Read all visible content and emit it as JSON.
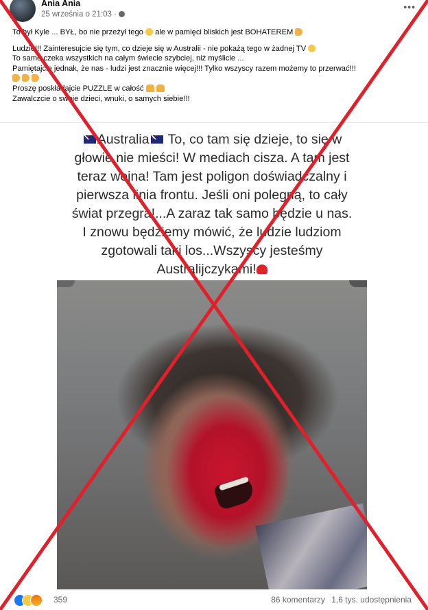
{
  "post": {
    "author": "Ania Ania",
    "timestamp": "25 września o 21:03 ·",
    "privacy_icon": "globe-icon",
    "more_icon": "ellipsis-icon",
    "text": {
      "line1": "To był Kyle ... BYŁ, bo nie przeżył tego",
      "line1_tail": "ale w pamięci bliskich jest BOHATEREM",
      "line2": "Ludzie!!! Zainteresujcie się tym, co dzieje się w Australii  - nie pokażą tego w żadnej TV",
      "line3": "To samo czeka wszystkich na całym świecie szybciej, niż myślicie ...",
      "line4": "Pamiętajcie jednak, że nas - ludzi jest znacznie więcej!!! Tylko wszyscy razem możemy to przerwać!!!",
      "line5": "Proszę poskładajcie PUZZLE w całość",
      "line6": "Zawalczcie o swoje dzieci, wnuki, o samych siebie!!!"
    }
  },
  "image": {
    "overlay_lines": [
      "Australia",
      "To, co tam się dzieje, to się w",
      "głowie nie mieści! W mediach cisza. A tam jest",
      "teraz wojna! Tam jest poligon doświadczalny i",
      "pierwsza linia frontu. Jeśli oni polegną, to cały",
      "świat przegra!...A zaraz tak samo będzie u nas.",
      "I znowu będziemy mówić, że ludzie ludziom",
      "zgotowali taki los...Wszyscy jesteśmy",
      "Australijczykami!"
    ]
  },
  "footer": {
    "reaction_icons": [
      "like-icon",
      "sad-icon",
      "angry-icon"
    ],
    "reaction_count": "359",
    "comments": "86 komentarzy",
    "shares": "1,6 tys. udostępnienia"
  },
  "colors": {
    "cross": "#e0202a",
    "meta_text": "#65676b",
    "like_blue": "#1877f2"
  }
}
